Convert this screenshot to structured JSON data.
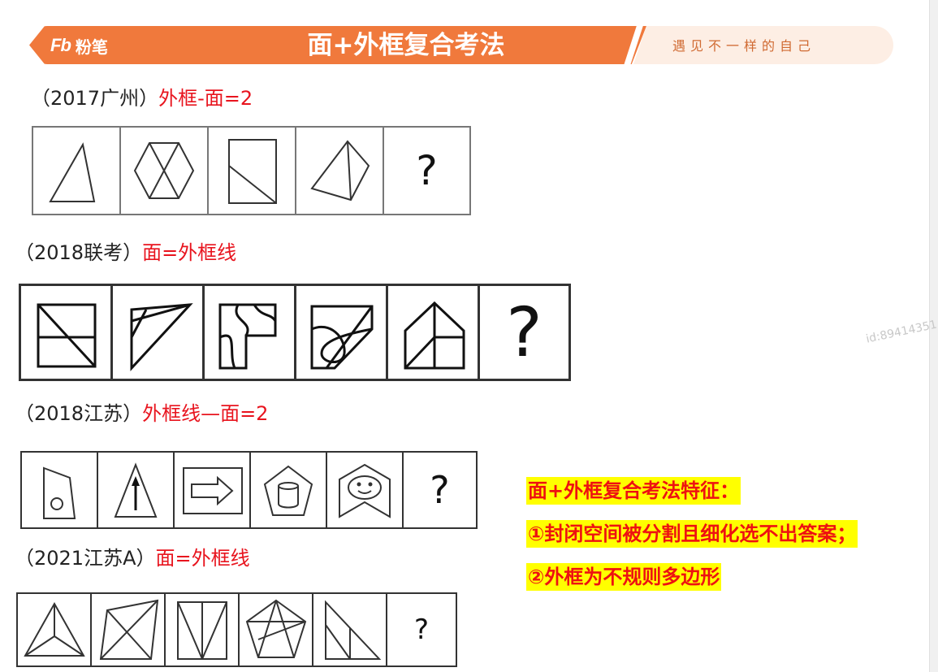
{
  "header": {
    "logo_mark": "Fb",
    "logo_text": "粉笔",
    "title": "面+外框复合考法",
    "slogan": "遇见不一样的自己"
  },
  "problems": [
    {
      "prefix": "（2017广州）",
      "rule": "外框-面=2"
    },
    {
      "prefix": "（2018联考）",
      "rule": "面=外框线"
    },
    {
      "prefix": "（2018江苏）",
      "rule": "外框线—面=2"
    },
    {
      "prefix": "（2021江苏A）",
      "rule": "面=外框线"
    }
  ],
  "question_mark": "?",
  "notes": {
    "title": "面+外框复合考法特征：",
    "point1": "①封闭空间被分割且细化选不出答案；",
    "point2": "②外框为不规则多边形"
  },
  "watermark": "id:89414351",
  "colors": {
    "banner": "#f0793c",
    "rule_text": "#e8141e",
    "highlight": "#ffff00"
  }
}
